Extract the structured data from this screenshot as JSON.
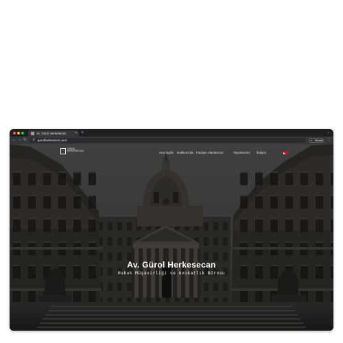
{
  "browser": {
    "tab_title": "Av. Gürol Herkesecan",
    "tab_close": "×",
    "new_tab": "+",
    "tab_chevron": "⌄",
    "url": "gurolherkesecan.av.tr",
    "profile_label": "Misafir",
    "icons": {
      "back": "arrow-left-icon",
      "forward": "arrow-right-icon",
      "reload": "reload-icon",
      "site_info": "site-info-icon",
      "profile": "guest-profile-icon",
      "menu": "kebab-menu-icon"
    },
    "colors": {
      "close_dot": "#ff5f57",
      "minimize_dot": "#febc2e",
      "maximize_dot": "#28c840",
      "frame": "#202124",
      "toolbar": "#35363a"
    }
  },
  "site": {
    "logo": {
      "line1": "GÜROL",
      "line2": "HERKESECAN"
    },
    "nav": [
      {
        "label": "Ana Sayfa"
      },
      {
        "label": "Hakkımızda"
      },
      {
        "label": "Faaliyet Alanlarımız"
      },
      {
        "label": "Yayınlarımız"
      },
      {
        "label": "İletişim"
      }
    ],
    "language_flag": "turkey-flag-icon",
    "hero": {
      "title": "Av. Gürol Herkesecan",
      "subtitle": "Hukuk Müşavirliği ve Avukatlık Bürosu",
      "background": "sorbonne-chapel-courtyard-photo"
    }
  }
}
